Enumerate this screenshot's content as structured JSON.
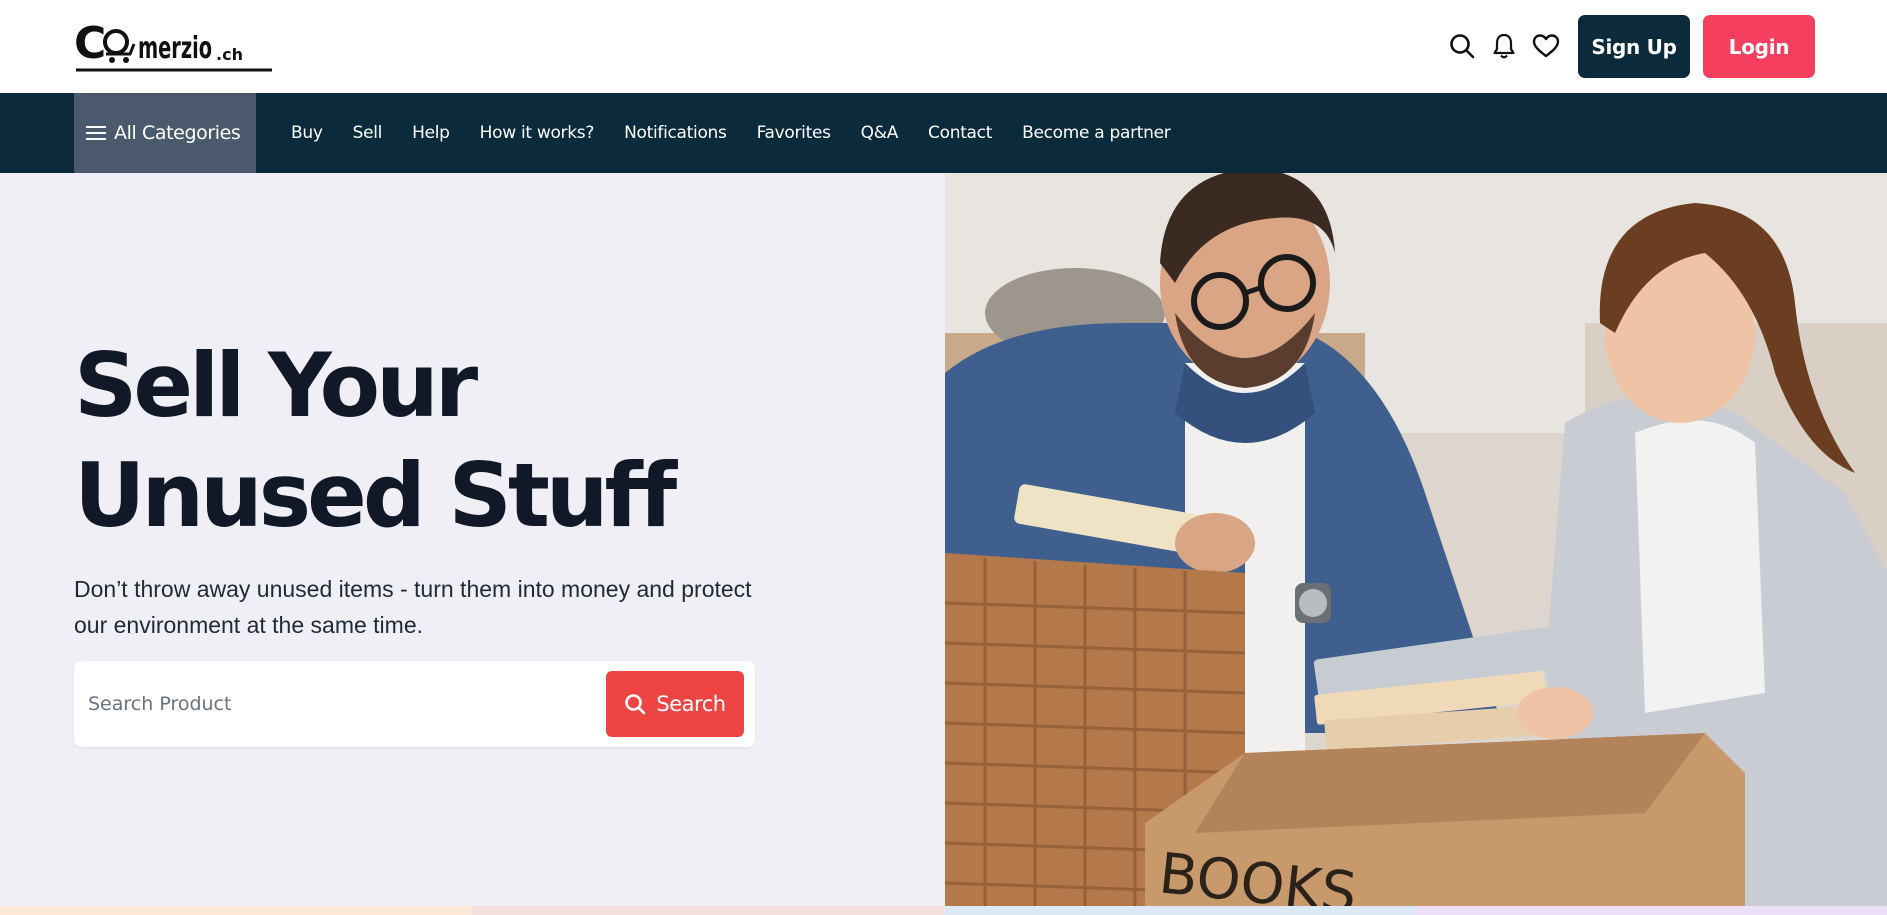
{
  "header": {
    "logo_text": "Comerzio.ch",
    "icons": [
      "search-icon",
      "bell-icon",
      "heart-icon"
    ],
    "signup_label": "Sign Up",
    "login_label": "Login"
  },
  "nav": {
    "all_categories_label": "All Categories",
    "items": [
      {
        "label": "Buy"
      },
      {
        "label": "Sell"
      },
      {
        "label": "Help"
      },
      {
        "label": "How it works?"
      },
      {
        "label": "Notifications"
      },
      {
        "label": "Favorites"
      },
      {
        "label": "Q&A"
      },
      {
        "label": "Contact"
      },
      {
        "label": "Become a partner"
      }
    ]
  },
  "hero": {
    "title_line1": "Sell Your",
    "title_line2": "Unused Stuff",
    "subtitle": "Don’t throw away unused items - turn them into money and protect our environment at the same time.",
    "search_placeholder": "Search Product",
    "search_button_label": "Search",
    "image_box_label": "BOOKS"
  },
  "colors": {
    "navy": "#0b2a3c",
    "accent_red": "#f43f5e",
    "search_red": "#ef4444",
    "hero_bg": "#f0eff5",
    "strips": [
      "#fde7d6",
      "#f5dede",
      "#dde9f7",
      "#ebe0f7"
    ]
  }
}
